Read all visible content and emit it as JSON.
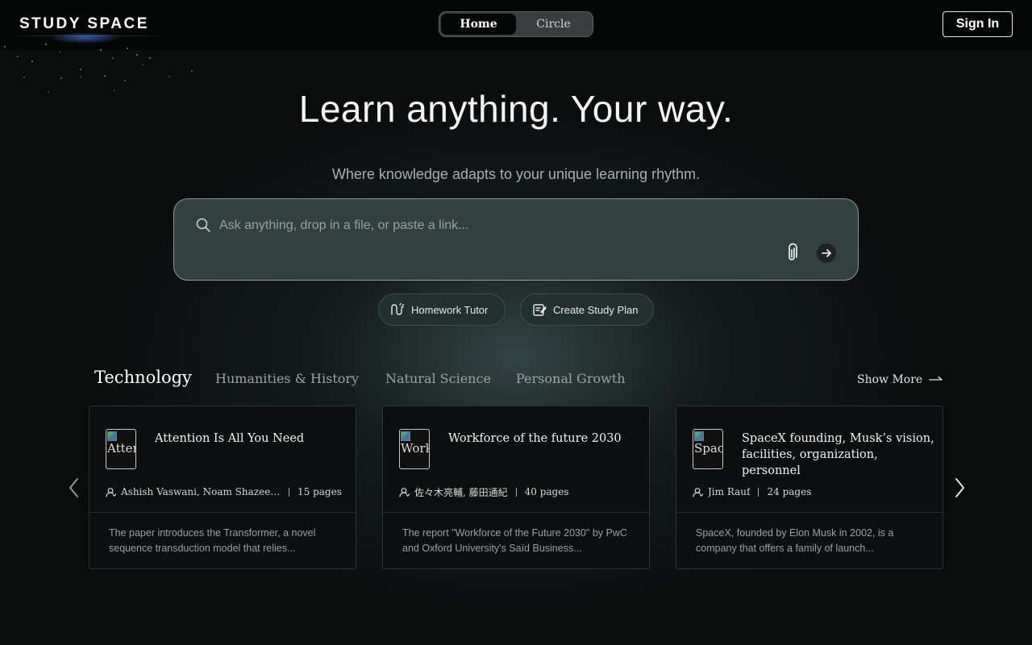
{
  "brand": {
    "name": "STUDY SPACE"
  },
  "nav": {
    "items": [
      {
        "label": "Home",
        "active": true
      },
      {
        "label": "Circle",
        "active": false
      }
    ],
    "sign_in_label": "Sign In"
  },
  "hero": {
    "title": "Learn anything. Your way.",
    "subtitle": "Where knowledge adapts to your unique learning rhythm."
  },
  "search": {
    "placeholder": "Ask anything, drop in a file, or paste a link...",
    "value": "",
    "icon": "search-icon",
    "attach_icon": "paperclip-icon",
    "submit_icon": "arrow-right-icon"
  },
  "quick_actions": [
    {
      "label": "Homework Tutor",
      "icon": "tutor-icon"
    },
    {
      "label": "Create Study Plan",
      "icon": "study-plan-icon"
    }
  ],
  "categories": {
    "items": [
      {
        "label": "Technology",
        "active": true
      },
      {
        "label": "Humanities & History",
        "active": false
      },
      {
        "label": "Natural Science",
        "active": false
      },
      {
        "label": "Personal Growth",
        "active": false
      }
    ],
    "show_more_label": "Show More"
  },
  "cards": [
    {
      "title": "Attention Is All You Need",
      "thumb_alt": "Atten",
      "authors": "Ashish Vaswani, Noam Shazeer, ...",
      "pages": "15 pages",
      "description": "The paper introduces the Transformer, a novel sequence transduction model that relies..."
    },
    {
      "title": "Workforce of the future 2030",
      "thumb_alt": "Workf",
      "authors": "佐々木亮輔, 藤田通紀",
      "pages": "40 pages",
      "description": "The report \"Workforce of the Future 2030\" by PwC and Oxford University's Saïd Business..."
    },
    {
      "title": "SpaceX founding, Musk’s vision, facilities, organization, personnel",
      "thumb_alt": "Space",
      "authors": "Jim Rauf",
      "pages": "24 pages",
      "description": "SpaceX, founded by Elon Musk in 2002, is a company that offers a family of launch..."
    }
  ],
  "carousel": {
    "prev_icon": "chevron-left-icon",
    "next_icon": "chevron-right-icon"
  },
  "colors": {
    "background": "#0b0d0d",
    "topbar": "#050606",
    "search_bg": "#334040",
    "chip_bg": "#233030",
    "card_bg": "#0c0f0f"
  }
}
